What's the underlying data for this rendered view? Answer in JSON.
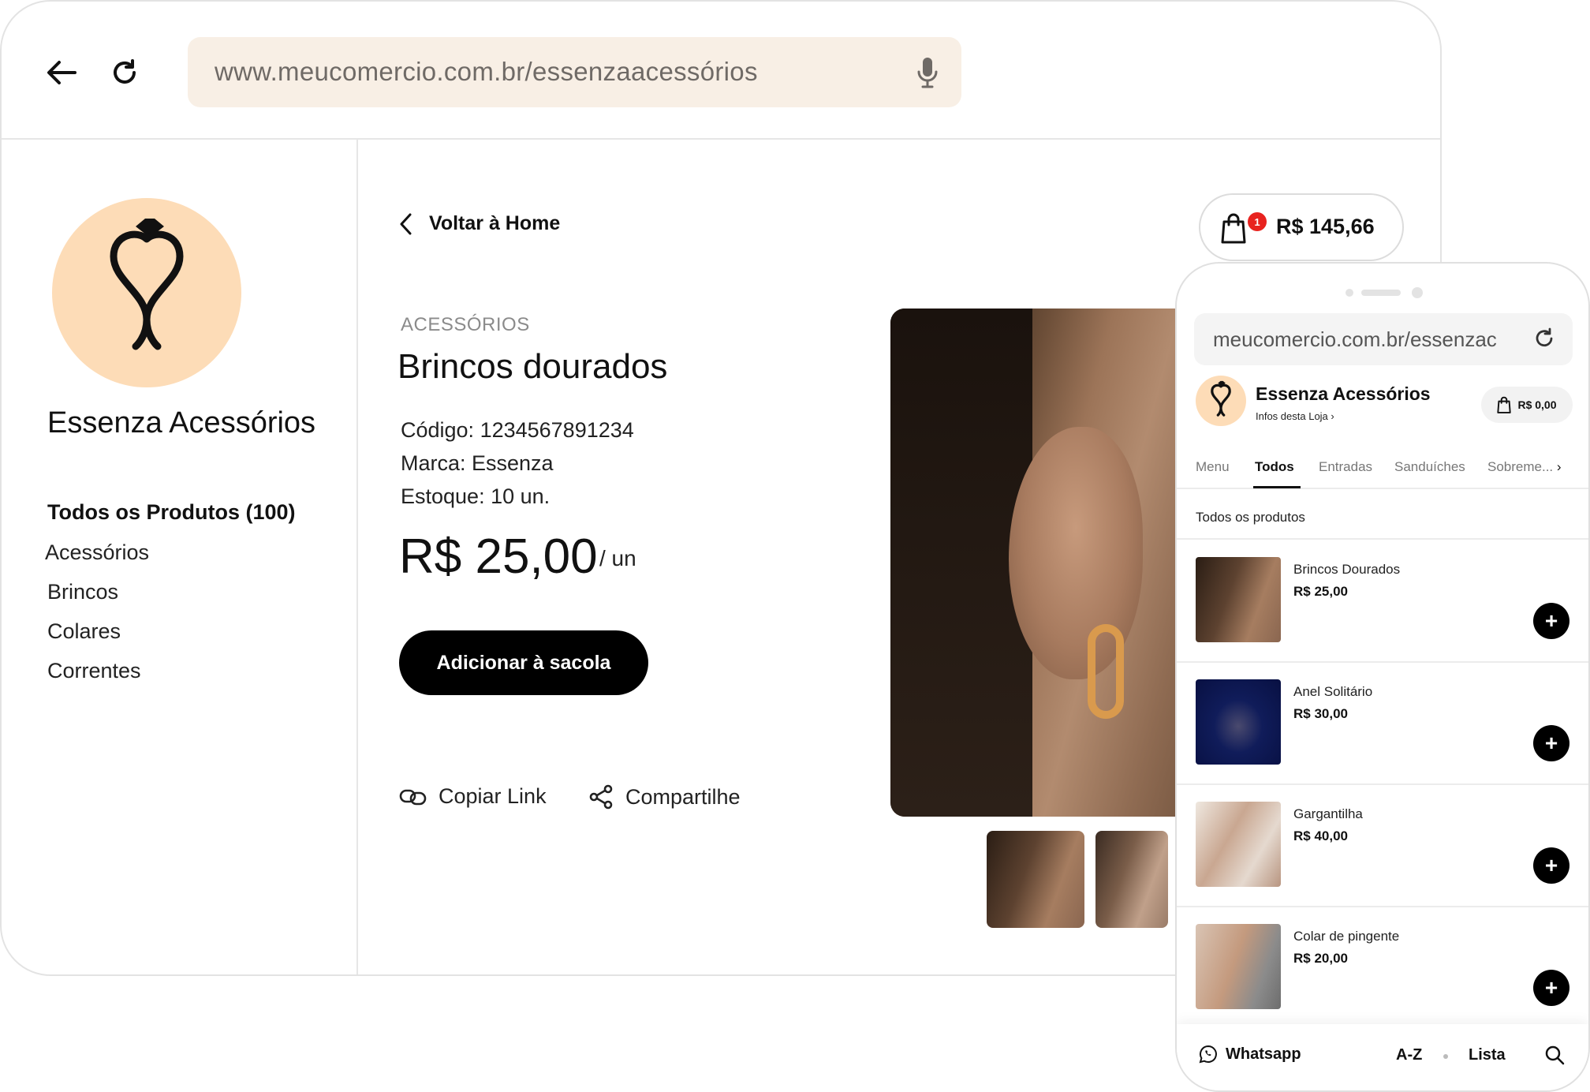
{
  "browser": {
    "url": "www.meucomercio.com.br/essenzaacessórios"
  },
  "sidebar": {
    "store_name": "Essenza Acessórios",
    "all_products": "Todos os Produtos (100)",
    "categories": [
      "Acessórios",
      "Brincos",
      "Colares",
      "Correntes"
    ]
  },
  "product": {
    "back_label": "Voltar à Home",
    "category": "ACESSÓRIOS",
    "title": "Brincos dourados",
    "code": "Código: 1234567891234",
    "brand": "Marca: Essenza",
    "stock": "Estoque: 10 un.",
    "price": "R$ 25,00",
    "unit": "/ un",
    "add_button": "Adicionar à sacola",
    "copy_link": "Copiar Link",
    "share": "Compartilhe"
  },
  "cart": {
    "badge": "1",
    "total": "R$ 145,66"
  },
  "mobile": {
    "url": "meucomercio.com.br/essenzac",
    "store_name": "Essenza Acessórios",
    "store_info": "Infos desta Loja",
    "cart_total": "R$ 0,00",
    "tabs": [
      "Menu",
      "Todos",
      "Entradas",
      "Sanduíches",
      "Sobreme..."
    ],
    "active_tab": 1,
    "section_title": "Todos os produtos",
    "items": [
      {
        "name": "Brincos Dourados",
        "price": "R$ 25,00"
      },
      {
        "name": "Anel Solitário",
        "price": "R$ 30,00"
      },
      {
        "name": "Gargantilha",
        "price": "R$ 40,00"
      },
      {
        "name": "Colar de pingente",
        "price": "R$ 20,00"
      }
    ],
    "bottom": {
      "whatsapp": "Whatsapp",
      "az": "A-Z",
      "list": "Lista"
    }
  },
  "colors": {
    "accent_peach": "#fddcb7",
    "url_bg": "#f8efe5",
    "badge_red": "#e8231f",
    "button_black": "#000000"
  }
}
